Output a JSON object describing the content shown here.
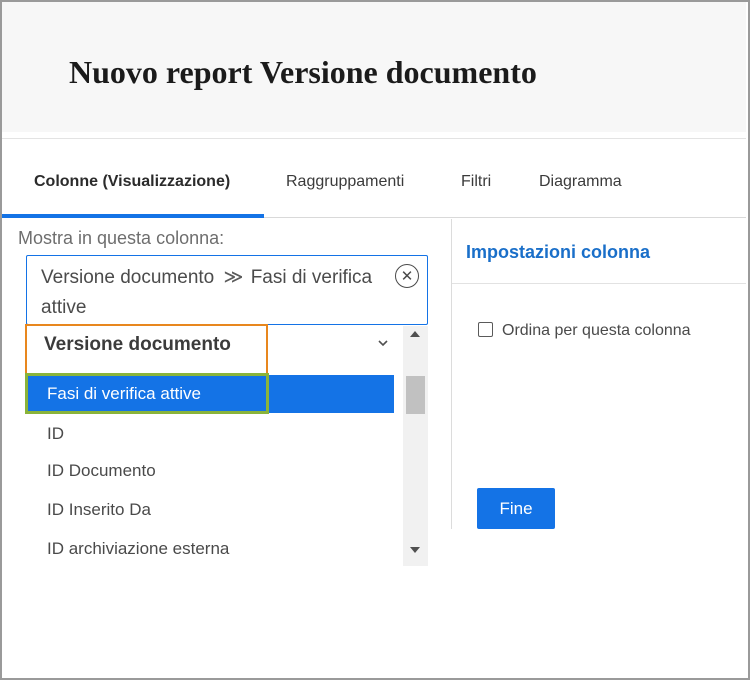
{
  "header": {
    "title": "Nuovo report Versione documento"
  },
  "tabs": [
    {
      "label": "Colonne (Visualizzazione)",
      "active": true
    },
    {
      "label": "Raggruppamenti",
      "active": false
    },
    {
      "label": "Filtri",
      "active": false
    },
    {
      "label": "Diagramma",
      "active": false
    }
  ],
  "column_field": {
    "label": "Mostra in questa colonna:",
    "path_parent": "Versione documento",
    "separator": "≫",
    "path_child": "Fasi di verifica attive",
    "clear_icon": "close-circle-icon"
  },
  "dropdown": {
    "group_label": "Versione documento",
    "group_icon": "chevron-down-icon",
    "items": [
      {
        "label": "Fasi di verifica attive",
        "selected": true
      },
      {
        "label": "ID",
        "selected": false
      },
      {
        "label": "ID Documento",
        "selected": false
      },
      {
        "label": "ID Inserito Da",
        "selected": false
      },
      {
        "label": "ID archiviazione esterna",
        "selected": false
      }
    ]
  },
  "settings": {
    "title": "Impostazioni colonna",
    "sort_checkbox_label": "Ordina per questa colonna",
    "sort_checked": false,
    "done_button": "Fine"
  },
  "colors": {
    "accent": "#1473e6",
    "highlight_orange": "#e8871e",
    "highlight_green": "#8ab43a"
  }
}
